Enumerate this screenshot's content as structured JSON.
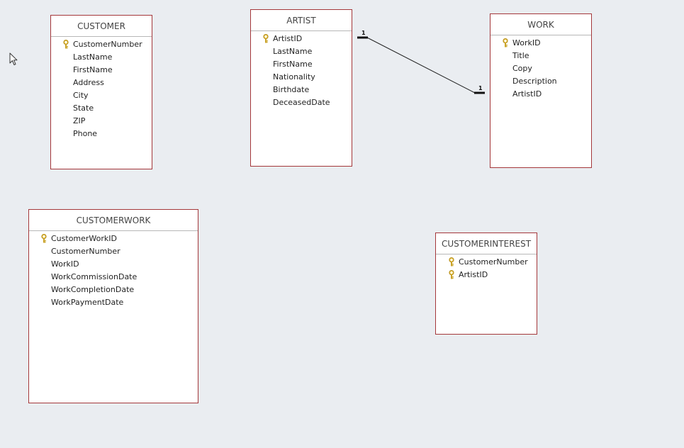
{
  "diagram": {
    "tables": [
      {
        "id": "customer",
        "name": "CUSTOMER",
        "fields": [
          {
            "name": "CustomerNumber",
            "primary_key": true
          },
          {
            "name": "LastName",
            "primary_key": false
          },
          {
            "name": "FirstName",
            "primary_key": false
          },
          {
            "name": "Address",
            "primary_key": false
          },
          {
            "name": "City",
            "primary_key": false
          },
          {
            "name": "State",
            "primary_key": false
          },
          {
            "name": "ZIP",
            "primary_key": false
          },
          {
            "name": "Phone",
            "primary_key": false
          }
        ]
      },
      {
        "id": "artist",
        "name": "ARTIST",
        "fields": [
          {
            "name": "ArtistID",
            "primary_key": true
          },
          {
            "name": "LastName",
            "primary_key": false
          },
          {
            "name": "FirstName",
            "primary_key": false
          },
          {
            "name": "Nationality",
            "primary_key": false
          },
          {
            "name": "Birthdate",
            "primary_key": false
          },
          {
            "name": "DeceasedDate",
            "primary_key": false
          }
        ]
      },
      {
        "id": "work",
        "name": "WORK",
        "fields": [
          {
            "name": "WorkID",
            "primary_key": true
          },
          {
            "name": "Title",
            "primary_key": false
          },
          {
            "name": "Copy",
            "primary_key": false
          },
          {
            "name": "Description",
            "primary_key": false
          },
          {
            "name": "ArtistID",
            "primary_key": false
          }
        ]
      },
      {
        "id": "customerwork",
        "name": "CUSTOMERWORK",
        "fields": [
          {
            "name": "CustomerWorkID",
            "primary_key": true
          },
          {
            "name": "CustomerNumber",
            "primary_key": false
          },
          {
            "name": "WorkID",
            "primary_key": false
          },
          {
            "name": "WorkCommissionDate",
            "primary_key": false
          },
          {
            "name": "WorkCompletionDate",
            "primary_key": false
          },
          {
            "name": "WorkPaymentDate",
            "primary_key": false
          }
        ]
      },
      {
        "id": "customerinterest",
        "name": "CUSTOMERINTEREST",
        "fields": [
          {
            "name": "CustomerNumber",
            "primary_key": true
          },
          {
            "name": "ArtistID",
            "primary_key": true
          }
        ]
      }
    ],
    "relationships": [
      {
        "from_table": "ARTIST",
        "from_field": "ArtistID",
        "from_cardinality": "1",
        "to_table": "WORK",
        "to_field": "ArtistID",
        "to_cardinality": "1"
      }
    ]
  },
  "colors": {
    "canvas_background": "#eaedf1",
    "table_border": "#a4373a",
    "key_icon": "#c9a227"
  },
  "icons": {
    "primary_key": "key-icon",
    "pointer": "mouse-cursor-icon"
  }
}
